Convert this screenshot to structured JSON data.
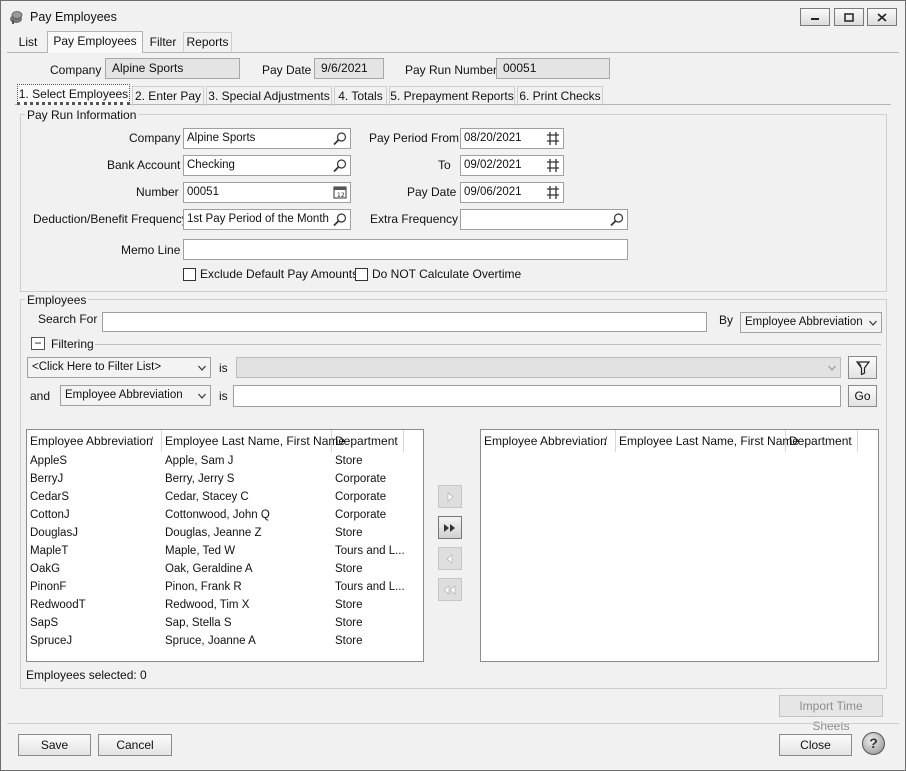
{
  "window": {
    "title": "Pay Employees"
  },
  "top_tabs": [
    {
      "label": "List"
    },
    {
      "label": "Pay Employees"
    },
    {
      "label": "Filter"
    },
    {
      "label": "Reports"
    }
  ],
  "header": {
    "company_label": "Company",
    "company_value": "Alpine Sports",
    "pay_date_label": "Pay Date",
    "pay_date_value": "9/6/2021",
    "pay_run_number_label": "Pay Run Number",
    "pay_run_number_value": "00051"
  },
  "step_tabs": [
    {
      "label": "1. Select Employees"
    },
    {
      "label": "2. Enter Pay"
    },
    {
      "label": "3. Special Adjustments"
    },
    {
      "label": "4. Totals"
    },
    {
      "label": "5. Prepayment Reports"
    },
    {
      "label": "6. Print Checks"
    }
  ],
  "pay_run_info": {
    "group_title": "Pay Run Information",
    "company_label": "Company",
    "company_value": "Alpine Sports",
    "bank_account_label": "Bank Account",
    "bank_account_value": "Checking",
    "number_label": "Number",
    "number_value": "00051",
    "deduction_label": "Deduction/Benefit Frequency",
    "deduction_value": "1st Pay Period of the Month",
    "memo_label": "Memo Line",
    "memo_value": "",
    "period_from_label": "Pay Period From",
    "period_from_value": "08/20/2021",
    "to_label": "To",
    "to_value": "09/02/2021",
    "pay_date_label": "Pay Date",
    "pay_date_value": "09/06/2021",
    "extra_frequency_label": "Extra Frequency",
    "extra_frequency_value": "",
    "exclude_label": "Exclude Default Pay Amounts",
    "exclude_checked": false,
    "no_overtime_label": "Do NOT Calculate Overtime",
    "no_overtime_checked": false
  },
  "employees": {
    "group_title": "Employees",
    "search_label": "Search For",
    "search_value": "",
    "by_label": "By",
    "by_value": "Employee Abbreviation",
    "filtering_label": "Filtering",
    "filtering_toggle": "−",
    "filter1_value": "<Click Here to Filter List>",
    "is1_label": "is",
    "filter1_operand": "",
    "and_label": "and",
    "filter2_value": "Employee Abbreviation",
    "is2_label": "is",
    "filter2_operand": "",
    "go_label": "Go",
    "columns": [
      "Employee Abbreviation",
      "Employee Last Name, First Name",
      "Department"
    ],
    "sort_indicator": "/",
    "available": [
      {
        "abbr": "AppleS",
        "name": "Apple, Sam J",
        "dept": "Store"
      },
      {
        "abbr": "BerryJ",
        "name": "Berry, Jerry S",
        "dept": "Corporate"
      },
      {
        "abbr": "CedarS",
        "name": "Cedar, Stacey C",
        "dept": "Corporate"
      },
      {
        "abbr": "CottonJ",
        "name": "Cottonwood, John Q",
        "dept": "Corporate"
      },
      {
        "abbr": "DouglasJ",
        "name": "Douglas, Jeanne Z",
        "dept": "Store"
      },
      {
        "abbr": "MapleT",
        "name": "Maple, Ted W",
        "dept": "Tours and L..."
      },
      {
        "abbr": "OakG",
        "name": "Oak, Geraldine A",
        "dept": "Store"
      },
      {
        "abbr": "PinonF",
        "name": "Pinon, Frank R",
        "dept": "Tours and L..."
      },
      {
        "abbr": "RedwoodT",
        "name": "Redwood, Tim X",
        "dept": "Store"
      },
      {
        "abbr": "SapS",
        "name": "Sap, Stella S",
        "dept": "Store"
      },
      {
        "abbr": "SpruceJ",
        "name": "Spruce, Joanne A",
        "dept": "Store"
      }
    ],
    "selected": [],
    "selected_count_text": "Employees selected: 0"
  },
  "buttons": {
    "import_label": "Import Time Sheets",
    "save_label": "Save",
    "cancel_label": "Cancel",
    "close_label": "Close",
    "help_glyph": "?"
  }
}
